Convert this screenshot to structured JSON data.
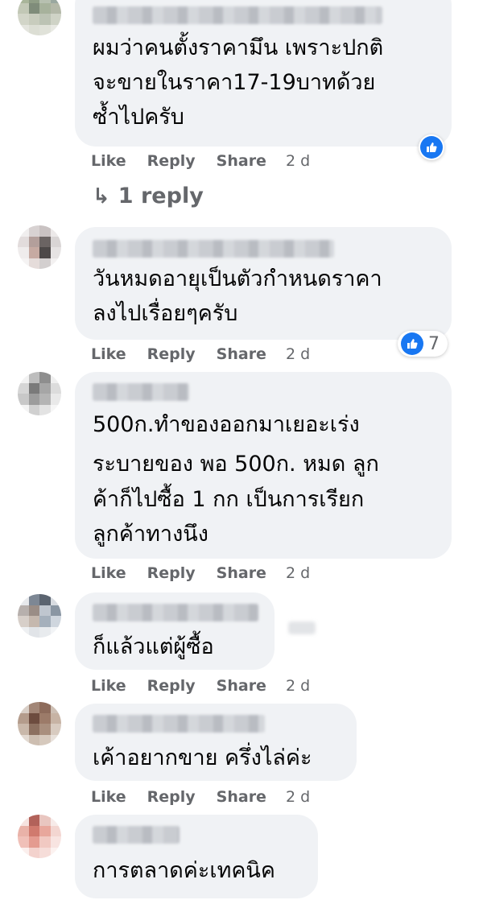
{
  "comments": [
    {
      "text_lines": [
        "ผมว่าคนตั้งราคามึน เพราะปกติ",
        "จะขายในราคา17-19บาทด้วย",
        "ซ้ำไปครับ"
      ],
      "actions": {
        "like": "Like",
        "reply": "Reply",
        "share": "Share",
        "time": "2 d"
      },
      "reaction": {
        "icon": "like-icon",
        "count": ""
      },
      "replies_link": {
        "icon": "reply-arrow-icon",
        "label": "1 reply"
      }
    },
    {
      "text_lines": [
        "วันหมดอายุเป็นตัวกำหนดราคา",
        "ลงไปเรื่อยๆครับ"
      ],
      "actions": {
        "like": "Like",
        "reply": "Reply",
        "share": "Share",
        "time": "2 d"
      },
      "reaction": {
        "icon": "like-icon",
        "count": "7"
      }
    },
    {
      "text_lines": [
        "500ก.ทำของออกมาเยอะเร่ง",
        "ระบายของ พอ 500ก. หมด ลูก",
        "ค้าก็ไปซื้อ 1 กก เป็นการเรียก",
        "ลูกค้าทางนึง"
      ],
      "actions": {
        "like": "Like",
        "reply": "Reply",
        "share": "Share",
        "time": "2 d"
      }
    },
    {
      "text_lines": [
        "ก็แล้วแต่ผู้ซื้อ"
      ],
      "actions": {
        "like": "Like",
        "reply": "Reply",
        "share": "Share",
        "time": "2 d"
      }
    },
    {
      "text_lines": [
        "เค้าอยากขาย ครึ่งไล่ค่ะ"
      ],
      "actions": {
        "like": "Like",
        "reply": "Reply",
        "share": "Share",
        "time": "2 d"
      }
    },
    {
      "text_lines": [
        "การตลาดค่ะเทคนิค"
      ]
    }
  ],
  "colors": {
    "bubble": "#f0f2f5",
    "action_text": "#65676b",
    "like_blue": "#1877f2"
  }
}
